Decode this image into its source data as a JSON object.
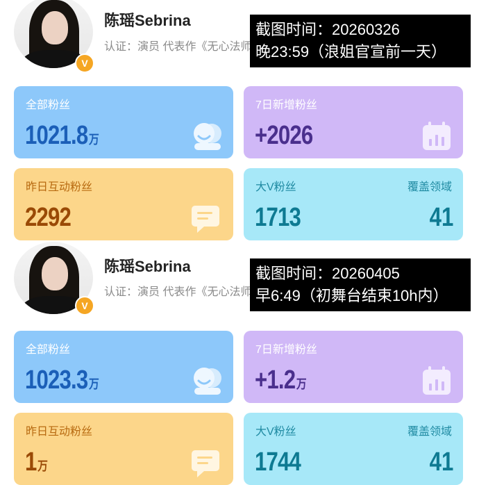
{
  "snapshots": [
    {
      "profile": {
        "name": "陈瑶Sebrina",
        "certification": "认证：演员 代表作《无心法师》",
        "verified_badge": "V"
      },
      "note": {
        "line1": "截图时间：20260326",
        "line2": "晚23:59（浪姐官宣前一天）"
      },
      "stats": {
        "total_fans": {
          "label": "全部粉丝",
          "value": "1021.8",
          "unit": "万"
        },
        "new_7d": {
          "label": "7日新增粉丝",
          "value": "+2026",
          "unit": ""
        },
        "interactive_yesterday": {
          "label": "昨日互动粉丝",
          "value": "2292",
          "unit": ""
        },
        "bigv": {
          "label": "大V粉丝",
          "value": "1713"
        },
        "coverage": {
          "label": "覆盖领域",
          "value": "41"
        }
      }
    },
    {
      "profile": {
        "name": "陈瑶Sebrina",
        "certification": "认证：演员 代表作《无心法师》",
        "verified_badge": "V"
      },
      "note": {
        "line1": "截图时间：20260405",
        "line2": "早6:49（初舞台结束10h内）"
      },
      "stats": {
        "total_fans": {
          "label": "全部粉丝",
          "value": "1023.3",
          "unit": "万"
        },
        "new_7d": {
          "label": "7日新增粉丝",
          "value": "+1.2",
          "unit": "万"
        },
        "interactive_yesterday": {
          "label": "昨日互动粉丝",
          "value": "1",
          "unit": "万"
        },
        "bigv": {
          "label": "大V粉丝",
          "value": "1744"
        },
        "coverage": {
          "label": "覆盖领域",
          "value": "41"
        }
      }
    }
  ],
  "colors": {
    "blue_card": "#8dc8fa",
    "purple_card": "#d0b8f7",
    "yellow_card": "#fcd68a",
    "cyan_card": "#a7e8f8",
    "badge": "#f5a623"
  },
  "icons": {
    "total_fans": "people-icon",
    "new_7d": "calendar-chart-icon",
    "interactive_yesterday": "chat-bubble-icon"
  }
}
